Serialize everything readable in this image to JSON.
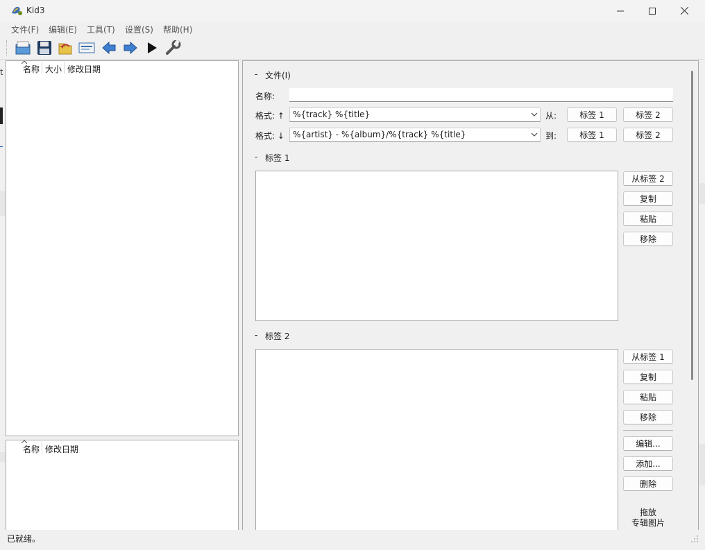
{
  "window": {
    "title": "Kid3",
    "app_icon": "kid3-app-icon",
    "controls": [
      "minimize-icon",
      "maximize-icon",
      "close-icon"
    ]
  },
  "menu": [
    "文件(F)",
    "编辑(E)",
    "工具(T)",
    "设置(S)",
    "帮助(H)"
  ],
  "toolbar": {
    "icons": [
      "open-folder-icon",
      "save-icon",
      "revert-icon",
      "settings-panel-icon",
      "previous-arrow-icon",
      "next-arrow-icon",
      "play-icon",
      "wrench-icon"
    ]
  },
  "file_list": {
    "columns": [
      "名称",
      "大小",
      "修改日期"
    ]
  },
  "dir_list": {
    "columns": [
      "名称",
      "修改日期"
    ]
  },
  "file_section": {
    "label": "文件(I)",
    "collapse_symbol": "-",
    "name_label": "名称:",
    "name_value": "",
    "format_from_label": "格式: ↑",
    "format_from_value": "%{track} %{title}",
    "from_label": "从:",
    "format_to_label": "格式: ↓",
    "format_to_value": "%{artist} - %{album}/%{track} %{title}",
    "to_label": "到:",
    "tag1_btn": "标签 1",
    "tag2_btn": "标签 2"
  },
  "tag1_section": {
    "label": "标签 1",
    "collapse_symbol": "-",
    "buttons": [
      "从标签 2",
      "复制",
      "粘贴",
      "移除"
    ]
  },
  "tag2_section": {
    "label": "标签 2",
    "collapse_symbol": "-",
    "buttons": [
      "从标签 1",
      "复制",
      "粘贴",
      "移除"
    ],
    "frame_buttons": [
      "编辑...",
      "添加...",
      "删除"
    ],
    "drop_text_1": "拖放",
    "drop_text_2": "专辑图片"
  },
  "status": {
    "text": "已就绪。"
  }
}
